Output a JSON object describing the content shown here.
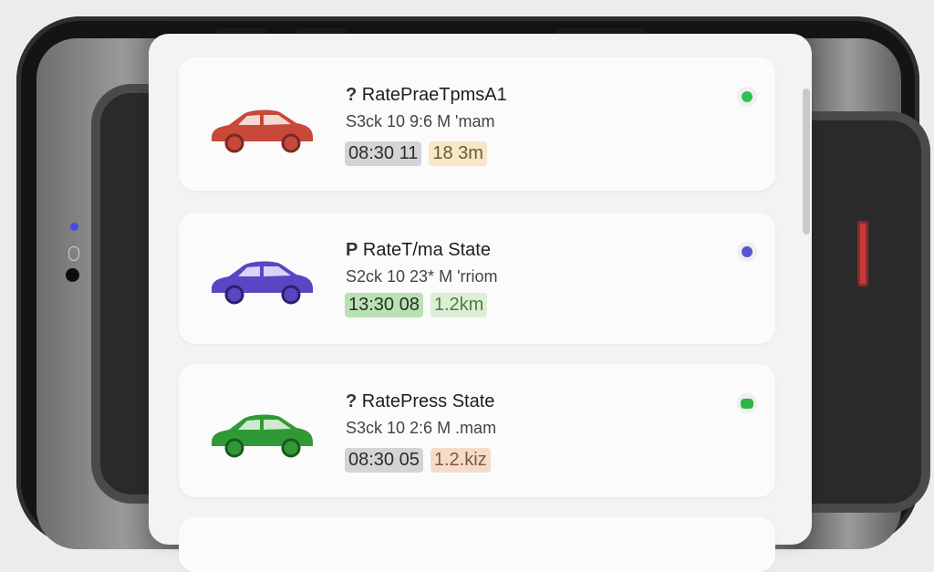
{
  "colors": {
    "bezel": "#141414",
    "panel": "#f3f3f4",
    "card": "#fbfbfb",
    "accent_blue": "#4646c8"
  },
  "vehicles": [
    {
      "icon": "car-icon",
      "car_color": "#c8483a",
      "title_glyph": "?",
      "title": "RatePraeTpmsA1",
      "subtitle": "S3ck 10 9:6 M 'mam",
      "time": "08:30 11",
      "time_bg": "#d4d4d4",
      "distance": "18 3m",
      "distance_bg": "#f6e7c7",
      "distance_color": "#6e5a2a",
      "status_color": "#2fbf55"
    },
    {
      "icon": "car-icon",
      "car_color": "#5a45c2",
      "title_glyph": "P",
      "title": "RateT/ma State",
      "subtitle": "S2ck 10 23* M 'rriom",
      "time": "13:30 08",
      "time_bg": "#b8e2b3",
      "distance": "1.2km",
      "distance_bg": "#dcefd6",
      "distance_color": "#4d7a45",
      "status_color": "#5a55d2"
    },
    {
      "icon": "car-icon",
      "car_color": "#2f9a35",
      "title_glyph": "?",
      "title": "RatePress State",
      "subtitle": "S3ck 10 2:6 M .mam",
      "time": "08:30 05",
      "time_bg": "#d4d4d4",
      "distance": "1.2.kiz",
      "distance_bg": "#f6dcc8",
      "distance_color": "#7a5a40",
      "status_color": "#2fb34a"
    }
  ]
}
